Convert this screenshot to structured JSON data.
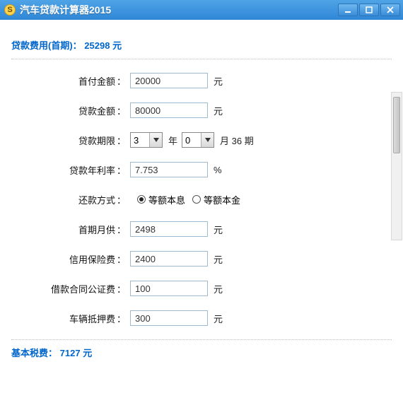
{
  "window": {
    "title": "汽车贷款计算器2015"
  },
  "summary": {
    "loan_fee_label": "贷款费用(首期)：",
    "loan_fee_value": "25298",
    "loan_fee_unit": "元",
    "tax_label": "基本税费：",
    "tax_value": "7127",
    "tax_unit": "元"
  },
  "form": {
    "down_payment": {
      "label": "首付金额",
      "value": "20000",
      "unit": "元"
    },
    "loan_amount": {
      "label": "贷款金额",
      "value": "80000",
      "unit": "元"
    },
    "loan_term": {
      "label": "贷款期限",
      "years": "3",
      "year_unit": "年",
      "months": "0",
      "month_unit": "月",
      "total": "36",
      "total_unit": "期"
    },
    "annual_rate": {
      "label": "贷款年利率",
      "value": "7.753",
      "unit": "%"
    },
    "repay_method": {
      "label": "还款方式",
      "options": [
        "等额本息",
        "等额本金"
      ],
      "selected": 0
    },
    "first_monthly": {
      "label": "首期月供",
      "value": "2498",
      "unit": "元"
    },
    "credit_ins": {
      "label": "信用保险费",
      "value": "2400",
      "unit": "元"
    },
    "notary_fee": {
      "label": "借款合同公证费",
      "value": "100",
      "unit": "元"
    },
    "mortgage_fee": {
      "label": "车辆抵押费",
      "value": "300",
      "unit": "元"
    }
  }
}
